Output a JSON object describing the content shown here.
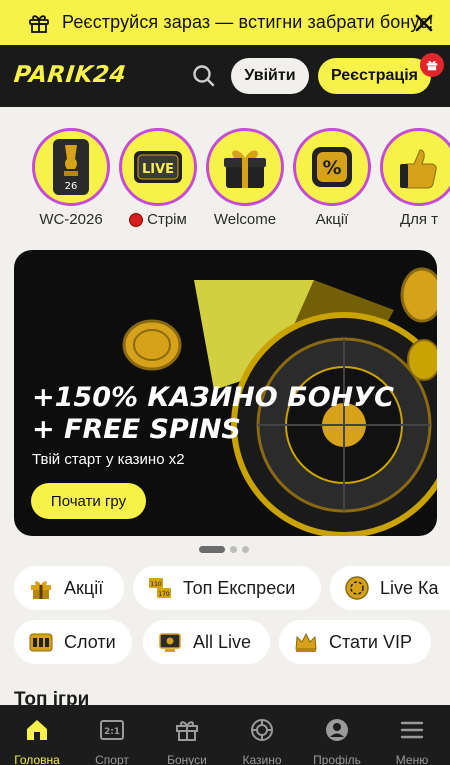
{
  "promo": {
    "text": "Реєструйся зараз — встигни забрати бонус!"
  },
  "header": {
    "logo": "PARIK24",
    "login_label": "Увійти",
    "register_label": "Реєстрація"
  },
  "stories": [
    {
      "label": "WC-2026",
      "badge": "26"
    },
    {
      "label": "Стрім",
      "badge": "LIVE"
    },
    {
      "label": "Welcome"
    },
    {
      "label": "Акції",
      "badge": "%"
    },
    {
      "label": "Для т"
    }
  ],
  "banner": {
    "title_line1": "+150% КАЗИНО БОНУС",
    "title_line2": "+ FREE SPINS",
    "subtitle": "Твій старт у казино x2",
    "cta": "Почати гру"
  },
  "carousel": {
    "total": 3,
    "active": 1
  },
  "chips_row1": [
    {
      "label": "Акції",
      "icon": "gift-icon"
    },
    {
      "label": "Топ Експреси",
      "icon": "express-icon"
    },
    {
      "label": "Live Ка",
      "icon": "chip-icon"
    }
  ],
  "chips_row2": [
    {
      "label": "Слоти",
      "icon": "slot-icon"
    },
    {
      "label": "All Live",
      "icon": "live-table-icon"
    },
    {
      "label": "Стати VIP",
      "icon": "crown-icon"
    }
  ],
  "section_title": "Топ ігри",
  "bottom_nav": [
    {
      "label": "Головна",
      "icon": "home-icon",
      "active": true
    },
    {
      "label": "Спорт",
      "icon": "scoreboard-icon",
      "badge": "2:1"
    },
    {
      "label": "Бонуси",
      "icon": "gift-icon"
    },
    {
      "label": "Казино",
      "icon": "roulette-icon"
    },
    {
      "label": "Профіль",
      "icon": "profile-icon"
    },
    {
      "label": "Меню",
      "icon": "menu-icon"
    }
  ],
  "colors": {
    "accent": "#f6f24a",
    "dark": "#1a1a1a",
    "background": "#f2f0ec",
    "story_ring": "#c64bd6",
    "badge_red": "#e2262b"
  }
}
